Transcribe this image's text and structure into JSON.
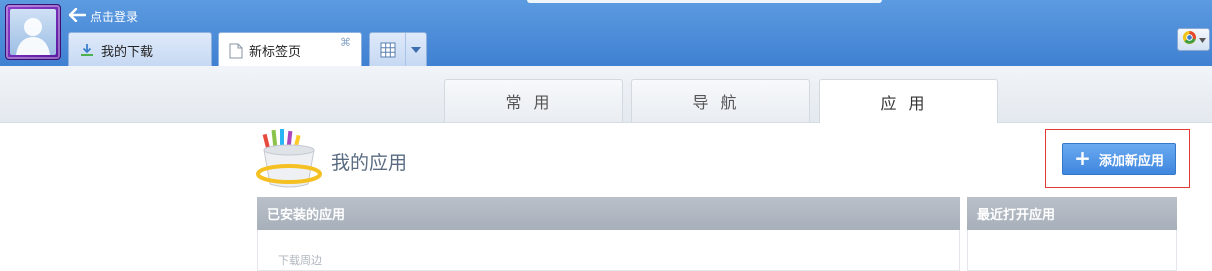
{
  "header": {
    "login_text": "点击登录",
    "tabs": [
      {
        "label": "我的下载",
        "icon": "download-icon"
      },
      {
        "label": "新标签页",
        "icon": "page-icon",
        "close_glyph": "⌘"
      }
    ]
  },
  "content_tabs": [
    {
      "label": "常用",
      "active": false
    },
    {
      "label": "导航",
      "active": false
    },
    {
      "label": "应用",
      "active": true
    }
  ],
  "app_page": {
    "title": "我的应用",
    "add_button_label": "添加新应用",
    "installed_panel": {
      "title": "已安装的应用",
      "items": [
        "下载周边"
      ]
    },
    "recent_panel": {
      "title": "最近打开应用"
    }
  },
  "colors": {
    "chrome_blue": "#4a8ad8",
    "accent_button": "#4b90e2",
    "highlight_red": "#e53935",
    "panel_header": "#adb4be"
  }
}
